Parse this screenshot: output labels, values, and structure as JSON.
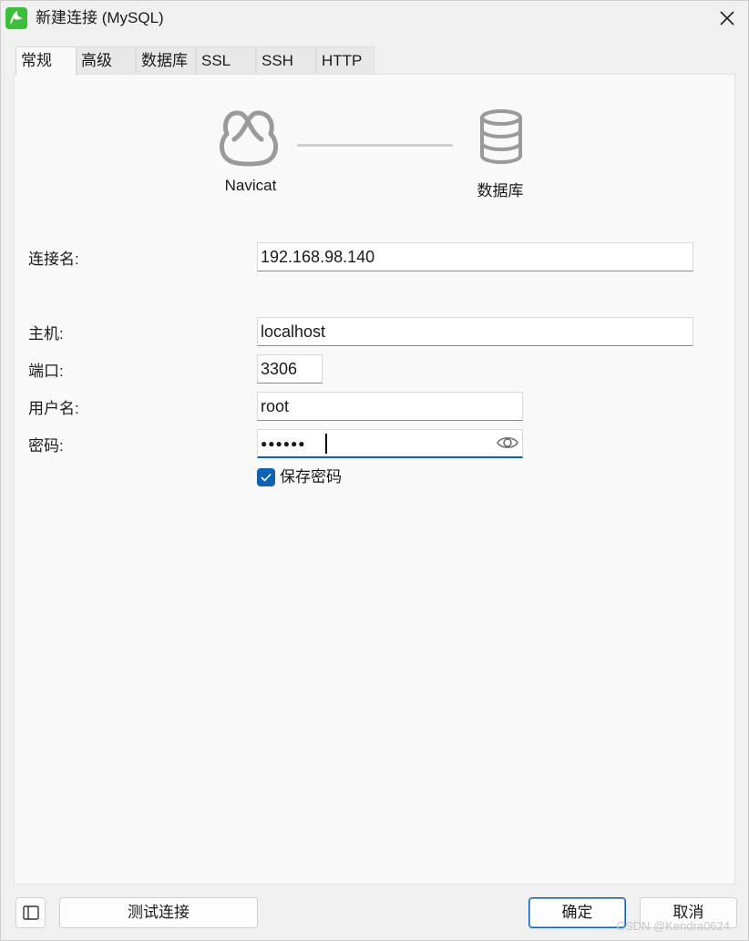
{
  "window": {
    "title": "新建连接 (MySQL)"
  },
  "tabs": [
    {
      "label": "常规",
      "active": true
    },
    {
      "label": "高级",
      "active": false
    },
    {
      "label": "数据库",
      "active": false
    },
    {
      "label": "SSL",
      "active": false
    },
    {
      "label": "SSH",
      "active": false
    },
    {
      "label": "HTTP",
      "active": false
    }
  ],
  "diagram": {
    "left_label": "Navicat",
    "right_label": "数据库"
  },
  "form": {
    "connection_name_label": "连接名:",
    "connection_name_value": "192.168.98.140",
    "host_label": "主机:",
    "host_value": "localhost",
    "port_label": "端口:",
    "port_value": "3306",
    "username_label": "用户名:",
    "username_value": "root",
    "password_label": "密码:",
    "password_mask": "●●●●●●",
    "save_password_label": "保存密码",
    "save_password_checked": true
  },
  "buttons": {
    "test_connection": "测试连接",
    "ok": "确定",
    "cancel": "取消"
  },
  "watermark": "CSDN @Kendra0624",
  "colors": {
    "accent": "#0f62b3",
    "navicat_icon": "#3cc03c"
  }
}
